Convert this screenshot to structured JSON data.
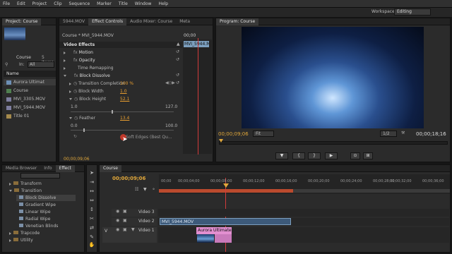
{
  "menu": [
    "File",
    "Edit",
    "Project",
    "Clip",
    "Sequence",
    "Marker",
    "Title",
    "Window",
    "Help"
  ],
  "workspace": {
    "label": "Workspace:",
    "value": "Editing"
  },
  "project": {
    "tab": "Project: Course",
    "clip_name": "Course",
    "items_count": "5 Items",
    "in_label": "In:",
    "in_value": "All",
    "name_header": "Name",
    "items": [
      "Aurora Ultimat",
      "Course",
      "MVI_3305.MOV",
      "MVI_5944.MOV",
      "Title 01"
    ]
  },
  "effect_controls": {
    "tabs": [
      "5944.MOV",
      "Effect Controls",
      "Audio Mixer: Course",
      "Meta"
    ],
    "clip_label": "Course * MVI_5944.MOV",
    "timecode_right": "00;00",
    "clip_chip": "MVI_5944.MOV",
    "section": "Video Effects",
    "effects": [
      {
        "name": "Motion"
      },
      {
        "name": "Opacity"
      },
      {
        "name": "Time Remapping"
      },
      {
        "name": "Block Dissolve"
      }
    ],
    "params": [
      {
        "name": "Transition Completion",
        "value": "100 %"
      },
      {
        "name": "Block Width",
        "value": "1.0"
      },
      {
        "name": "Block Height",
        "value": "52.1"
      },
      {
        "name": "Feather",
        "value": "13.4"
      }
    ],
    "range1": {
      "min": "1.0",
      "max": "127.0"
    },
    "range2": {
      "min": "0.0",
      "max": "100.0"
    },
    "soft_edges": "Soft Edges (Best Qu...",
    "timecode_bottom": "00;00;09;06"
  },
  "program": {
    "tab": "Program: Course",
    "timecode_left": "00;00;09;06",
    "fit": "Fit",
    "page": "1/2",
    "timecode_right": "00;00;18;16"
  },
  "browser": {
    "tabs": [
      "Media Browser",
      "Info",
      "Effect"
    ],
    "items": [
      {
        "label": "Transform",
        "indent": 1
      },
      {
        "label": "Transition",
        "indent": 1
      },
      {
        "label": "Block Dissolve",
        "indent": 2
      },
      {
        "label": "Gradient Wipe",
        "indent": 2
      },
      {
        "label": "Linear Wipe",
        "indent": 2
      },
      {
        "label": "Radial Wipe",
        "indent": 2
      },
      {
        "label": "Venetian Blinds",
        "indent": 2
      },
      {
        "label": "Trapcode",
        "indent": 1
      },
      {
        "label": "Utility",
        "indent": 1
      }
    ]
  },
  "timeline": {
    "tab": "Course",
    "timecode": "00;00;09;06",
    "ruler": [
      "00;00",
      "00;00;04;00",
      "00;00;08;00",
      "00;00;12;00",
      "00;00;16;00",
      "00;00;20;00",
      "00;00;24;00",
      "00;00;28;00",
      "00;00;32;00",
      "00;00;36;00"
    ],
    "tracks": [
      "Video 3",
      "Video 2",
      "Video 1"
    ],
    "track_v1_prefix": "V",
    "clips": {
      "v2": "MVI_5944.MOV",
      "v1": "Aurora Ultimate - 3"
    }
  },
  "colors": {
    "accent": "#e0a73a",
    "playhead": "#d23c3c",
    "clip_blue": "#7c9fbe",
    "clip_pink": "#e28fd0"
  }
}
